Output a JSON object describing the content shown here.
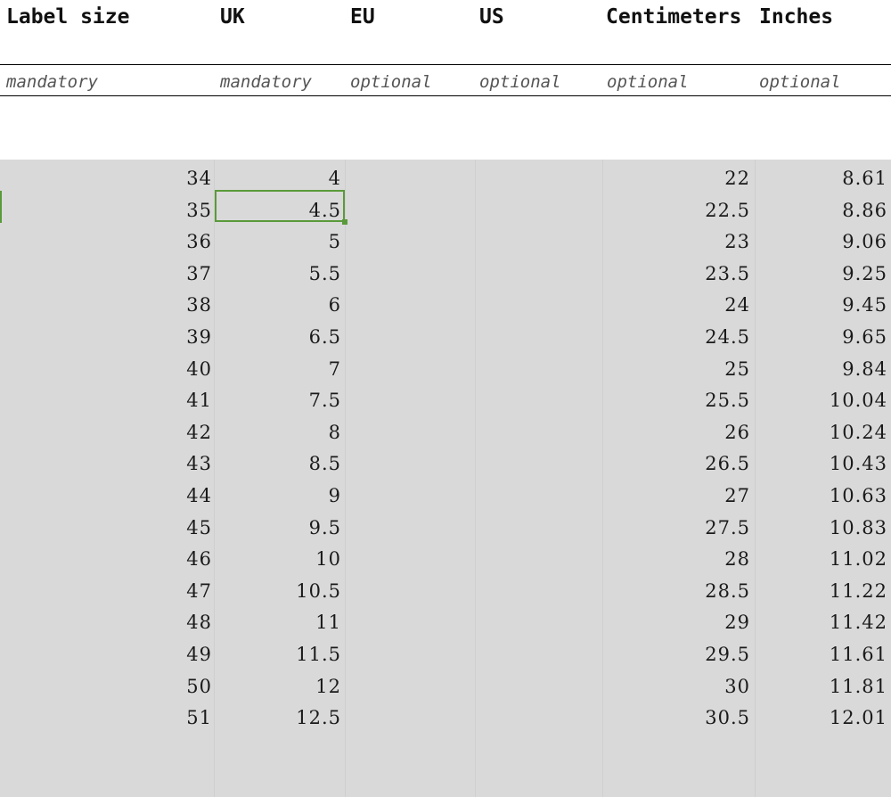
{
  "headers": {
    "label_size": "Label size",
    "uk": "UK",
    "eu": "EU",
    "us": "US",
    "centimeters": "Centimeters",
    "inches": "Inches"
  },
  "requirements": {
    "label_size": "mandatory",
    "uk": "mandatory",
    "eu": "optional",
    "us": "optional",
    "centimeters": "optional",
    "inches": "optional"
  },
  "rows": [
    {
      "label": "34",
      "uk": "4",
      "eu": "",
      "us": "",
      "cm": "22",
      "in": "8.61"
    },
    {
      "label": "35",
      "uk": "4.5",
      "eu": "",
      "us": "",
      "cm": "22.5",
      "in": "8.86"
    },
    {
      "label": "36",
      "uk": "5",
      "eu": "",
      "us": "",
      "cm": "23",
      "in": "9.06"
    },
    {
      "label": "37",
      "uk": "5.5",
      "eu": "",
      "us": "",
      "cm": "23.5",
      "in": "9.25"
    },
    {
      "label": "38",
      "uk": "6",
      "eu": "",
      "us": "",
      "cm": "24",
      "in": "9.45"
    },
    {
      "label": "39",
      "uk": "6.5",
      "eu": "",
      "us": "",
      "cm": "24.5",
      "in": "9.65"
    },
    {
      "label": "40",
      "uk": "7",
      "eu": "",
      "us": "",
      "cm": "25",
      "in": "9.84"
    },
    {
      "label": "41",
      "uk": "7.5",
      "eu": "",
      "us": "",
      "cm": "25.5",
      "in": "10.04"
    },
    {
      "label": "42",
      "uk": "8",
      "eu": "",
      "us": "",
      "cm": "26",
      "in": "10.24"
    },
    {
      "label": "43",
      "uk": "8.5",
      "eu": "",
      "us": "",
      "cm": "26.5",
      "in": "10.43"
    },
    {
      "label": "44",
      "uk": "9",
      "eu": "",
      "us": "",
      "cm": "27",
      "in": "10.63"
    },
    {
      "label": "45",
      "uk": "9.5",
      "eu": "",
      "us": "",
      "cm": "27.5",
      "in": "10.83"
    },
    {
      "label": "46",
      "uk": "10",
      "eu": "",
      "us": "",
      "cm": "28",
      "in": "11.02"
    },
    {
      "label": "47",
      "uk": "10.5",
      "eu": "",
      "us": "",
      "cm": "28.5",
      "in": "11.22"
    },
    {
      "label": "48",
      "uk": "11",
      "eu": "",
      "us": "",
      "cm": "29",
      "in": "11.42"
    },
    {
      "label": "49",
      "uk": "11.5",
      "eu": "",
      "us": "",
      "cm": "29.5",
      "in": "11.61"
    },
    {
      "label": "50",
      "uk": "12",
      "eu": "",
      "us": "",
      "cm": "30",
      "in": "11.81"
    },
    {
      "label": "51",
      "uk": "12.5",
      "eu": "",
      "us": "",
      "cm": "30.5",
      "in": "12.01"
    }
  ],
  "selected": {
    "row": 1,
    "column": "uk"
  },
  "colors": {
    "selection": "#5a9a3a",
    "data_fill": "#d9d9d9"
  }
}
